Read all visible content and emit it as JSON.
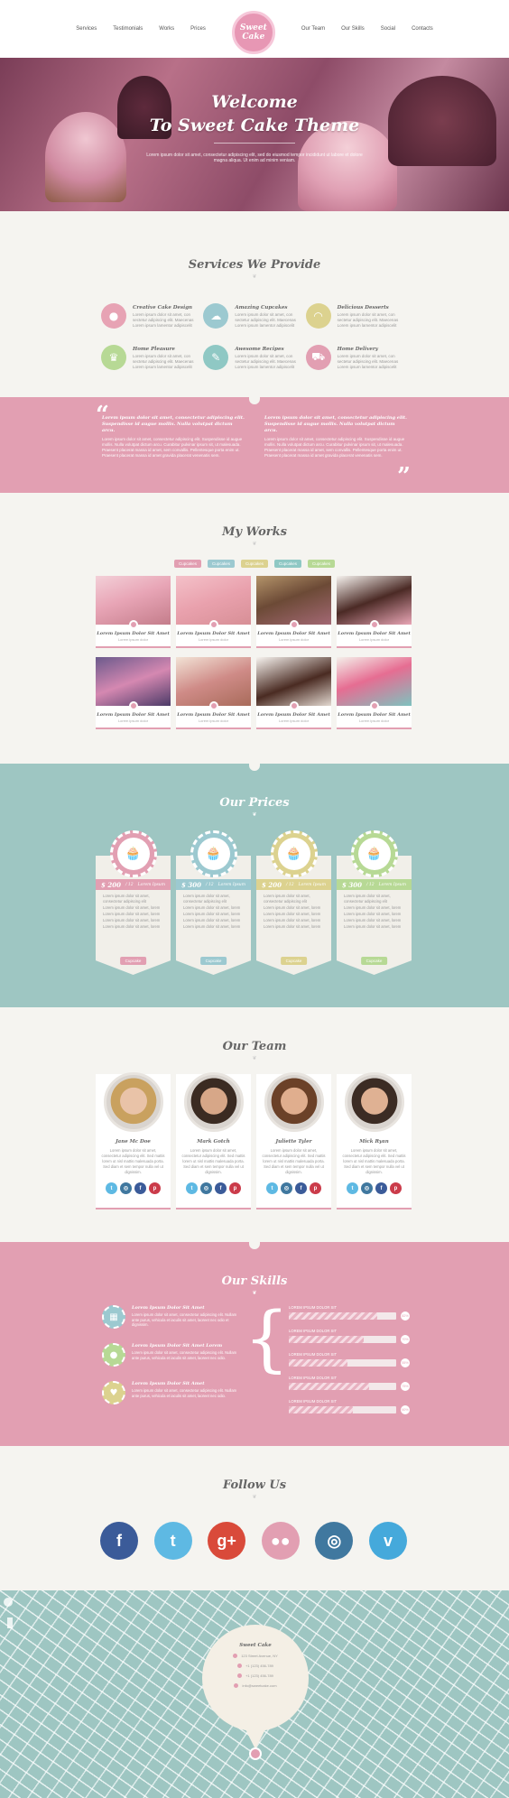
{
  "nav": {
    "left": [
      "Services",
      "Testimonials",
      "Works",
      "Prices"
    ],
    "right": [
      "Our Team",
      "Our Skills",
      "Social",
      "Contacts"
    ],
    "logo_line1": "Sweet",
    "logo_line2": "Cake"
  },
  "hero": {
    "line1": "Welcome",
    "line2": "To Sweet Cake Theme",
    "text": "Lorem ipsum dolor sit amet, consectetur adipiscing elit, sed do eiusmod tempor incididunt ut labore et dolore magna aliqua. Ut enim ad minim veniam."
  },
  "services": {
    "title": "Services We Provide",
    "items": [
      {
        "title": "Creative Cake Design",
        "text": "Lorem ipsum dolor sit amet, con sectetur adipiscing elit. Maecenas Lorem ipsum lamentor adipiscelit",
        "icon": "apple-icon",
        "color": "#e7a3b4"
      },
      {
        "title": "Amazing Cupcakes",
        "text": "Lorem ipsum dolor sit amet, con sectetur adipiscing elit. Maecenas Lorem ipsum lamentor adipiscelit",
        "icon": "cupcake-icon",
        "color": "#9cc9d0"
      },
      {
        "title": "Delicious Desserts",
        "text": "Lorem ipsum dolor sit amet, con sectetur adipiscing elit. Maecenas Lorem ipsum lamentor adipiscelit",
        "icon": "croissant-icon",
        "color": "#dcd28f"
      },
      {
        "title": "Home Pleasure",
        "text": "Lorem ipsum dolor sit amet, con sectetur adipiscing elit. Maecenas Lorem ipsum lamentor adipiscelit",
        "icon": "chef-hat-icon",
        "color": "#b7d995"
      },
      {
        "title": "Awesome Recipes",
        "text": "Lorem ipsum dolor sit amet, con sectetur adipiscing elit. Maecenas Lorem ipsum lamentor adipiscelit",
        "icon": "recipe-icon",
        "color": "#8fc8c4"
      },
      {
        "title": "Home Delivery",
        "text": "Lorem ipsum dolor sit amet, con sectetur adipiscing elit. Maecenas Lorem ipsum lamentor adipiscelit",
        "icon": "delivery-icon",
        "color": "#e29fb2"
      }
    ]
  },
  "testimonials": [
    {
      "quote": "Lorem ipsum dolor sit amet, consectetur adipiscing elit. Suspendisse id augue mollis. Nulla volutpat dictum arcu.",
      "text": "Lorem ipsum dolor sit amet, consectetur adipiscing elit. Suspendisse id augue mollis. Nulla volutpat dictum arcu. Curabitur pulvinar ipsum sit, ut malesuada. Praesent placerat massa id amet, sem convallis. Pellentesque porta enim ut. Praesent placerat massa id amet gravida placerat venenatis sem."
    },
    {
      "quote": "Lorem ipsum dolor sit amet, consectetur adipiscing elit. Suspendisse id augue mollis. Nulla volutpat dictum arcu.",
      "text": "Lorem ipsum dolor sit amet, consectetur adipiscing elit. Suspendisse id augue mollis. Nulla volutpat dictum arcu. Curabitur pulvinar ipsum sit, ut malesuada. Praesent placerat massa id amet, sem convallis. Pellentesque porta enim ut. Praesent placerat massa id amet gravida placerat venenatis sem."
    }
  ],
  "works": {
    "title": "My Works",
    "filters": [
      {
        "label": "Cupcakes",
        "color": "#e29fb2"
      },
      {
        "label": "Cupcakes",
        "color": "#9cc9d0"
      },
      {
        "label": "Cupcakes",
        "color": "#dcd28f"
      },
      {
        "label": "Cupcakes",
        "color": "#8fc8c4"
      },
      {
        "label": "Cupcakes",
        "color": "#b7d995"
      }
    ],
    "items": [
      {
        "title": "Lorem Ipsum Dolor Sit Amet",
        "sub": "Lorem ipsum dolor",
        "bg": "linear-gradient(160deg,#f3d0d8,#e8a5b6 45%,#c47d8b)"
      },
      {
        "title": "Lorem Ipsum Dolor Sit Amet",
        "sub": "Lorem ipsum dolor",
        "bg": "linear-gradient(160deg,#f4c1c9,#e9a1ad 50%,#d78f96)"
      },
      {
        "title": "Lorem Ipsum Dolor Sit Amet",
        "sub": "Lorem ipsum dolor",
        "bg": "linear-gradient(160deg,#b4946a,#6c4a36 45%,#a36874)"
      },
      {
        "title": "Lorem Ipsum Dolor Sit Amet",
        "sub": "Lorem ipsum dolor",
        "bg": "linear-gradient(160deg,#f6f2ee,#4b2a25 50%,#e9a6b6)"
      },
      {
        "title": "Lorem Ipsum Dolor Sit Amet",
        "sub": "Lorem ipsum dolor",
        "bg": "linear-gradient(160deg,#6b5a8c,#d588b1 50%,#4c3b68)"
      },
      {
        "title": "Lorem Ipsum Dolor Sit Amet",
        "sub": "Lorem ipsum dolor",
        "bg": "linear-gradient(160deg,#f2e3d6,#cf8b87 50%,#a86b5a)"
      },
      {
        "title": "Lorem Ipsum Dolor Sit Amet",
        "sub": "Lorem ipsum dolor",
        "bg": "linear-gradient(160deg,#f7f3ef,#4a2b22 55%,#e2d8d0)"
      },
      {
        "title": "Lorem Ipsum Dolor Sit Amet",
        "sub": "Lorem ipsum dolor",
        "bg": "linear-gradient(160deg,#f4f0ea,#e66d92 45%,#7ec2bf)"
      }
    ]
  },
  "prices": {
    "title": "Our Prices",
    "items": [
      {
        "price": "$ 200",
        "per": "/ 12",
        "name": "Lorem Ipsum",
        "color": "#e29fb2",
        "button": "Cupcake",
        "features": [
          "Lorem ipsum dolor sit amet, consectetur adipiscing elit",
          "Lorem ipsum dolor sit amet, lorem",
          "Lorem ipsum dolor sit amet, lorem",
          "Lorem ipsum dolor sit amet, lorem",
          "Lorem ipsum dolor sit amet, lorem"
        ]
      },
      {
        "price": "$ 300",
        "per": "/ 12",
        "name": "Lorem Ipsum",
        "color": "#9cc9d0",
        "button": "Cupcake",
        "features": [
          "Lorem ipsum dolor sit amet, consectetur adipiscing elit",
          "Lorem ipsum dolor sit amet, lorem",
          "Lorem ipsum dolor sit amet, lorem",
          "Lorem ipsum dolor sit amet, lorem",
          "Lorem ipsum dolor sit amet, lorem"
        ]
      },
      {
        "price": "$ 200",
        "per": "/ 12",
        "name": "Lorem Ipsum",
        "color": "#dcd28f",
        "button": "Cupcake",
        "features": [
          "Lorem ipsum dolor sit amet, consectetur adipiscing elit",
          "Lorem ipsum dolor sit amet, lorem",
          "Lorem ipsum dolor sit amet, lorem",
          "Lorem ipsum dolor sit amet, lorem",
          "Lorem ipsum dolor sit amet, lorem"
        ]
      },
      {
        "price": "$ 300",
        "per": "/ 12",
        "name": "Lorem Ipsum",
        "color": "#b7d995",
        "button": "Cupcake",
        "features": [
          "Lorem ipsum dolor sit amet, consectetur adipiscing elit",
          "Lorem ipsum dolor sit amet, lorem",
          "Lorem ipsum dolor sit amet, lorem",
          "Lorem ipsum dolor sit amet, lorem",
          "Lorem ipsum dolor sit amet, lorem"
        ]
      }
    ]
  },
  "team": {
    "title": "Our Team",
    "members": [
      {
        "name": "Jane Mc Doe",
        "text": "Lorem ipsum dolor sit amet, consectetur adipiscing elit. Sed mattis lorem ut nisl mattis malesuada porta. Sed diam et sem tempor nulla vel ut dignissim.",
        "skin": "#e9c3a8",
        "hair": "#c9a15f"
      },
      {
        "name": "Mark Gotch",
        "text": "Lorem ipsum dolor sit amet, consectetur adipiscing elit. Sed mattis lorem ut nisl mattis malesuada porta. Sed diam et sem tempor nulla vel ut dignissim.",
        "skin": "#d7a788",
        "hair": "#3b2b22"
      },
      {
        "name": "Juliette Tyler",
        "text": "Lorem ipsum dolor sit amet, consectetur adipiscing elit. Sed mattis lorem ut nisl mattis malesuada porta. Sed diam et sem tempor nulla vel ut dignissim.",
        "skin": "#e0ae8e",
        "hair": "#6b4128"
      },
      {
        "name": "Mick Ryan",
        "text": "Lorem ipsum dolor sit amet, consectetur adipiscing elit. Sed mattis lorem ut nisl mattis malesuada porta. Sed diam et sem tempor nulla vel ut dignissim.",
        "skin": "#dfb193",
        "hair": "#3c2c24"
      }
    ],
    "social": [
      {
        "icon": "twitter-icon",
        "glyph": "t",
        "color": "#5eb9e3"
      },
      {
        "icon": "instagram-icon",
        "glyph": "◎",
        "color": "#40789f"
      },
      {
        "icon": "facebook-icon",
        "glyph": "f",
        "color": "#3b5b99"
      },
      {
        "icon": "pinterest-icon",
        "glyph": "p",
        "color": "#cb3b4a"
      }
    ]
  },
  "skills": {
    "title": "Our Skills",
    "items": [
      {
        "title": "Lorem Ipsum Dolor Sit Amet",
        "text": "Lorem ipsum dolor sit amet, consectetur adipiscing elit. Nullam ante purus, vehicula et iaculis sit amet, laoreet nec odio et dignissim.",
        "icon": "calendar-icon",
        "glyph": "▦",
        "color": "#9cc9d0"
      },
      {
        "title": "Lorem Ipsum Dolor Sit Amet Lorem",
        "text": "Lorem ipsum dolor sit amet, consectetur adipiscing elit. Nullam ante purus, vehicula et iaculis sit amet, laoreet nec odio.",
        "icon": "apple-icon",
        "glyph": "●",
        "color": "#b7d995"
      },
      {
        "title": "Lorem Ipsum Dolor Sit Amet",
        "text": "Lorem ipsum dolor sit amet, consectetur adipiscing elit. Nullam ante purus, vehicula et iaculis sit amet, laoreet nec odio.",
        "icon": "heart-icon",
        "glyph": "♥",
        "color": "#dcd28f"
      }
    ],
    "bars": [
      {
        "label": "LOREM IPSUM DOLOR SIT",
        "value": 0.82,
        "pct": "82%"
      },
      {
        "label": "LOREM IPSUM DOLOR SIT",
        "value": 0.7,
        "pct": "70%"
      },
      {
        "label": "LOREM IPSUM DOLOR SIT",
        "value": 0.55,
        "pct": "55%"
      },
      {
        "label": "LOREM IPSUM DOLOR SIT",
        "value": 0.75,
        "pct": "75%"
      },
      {
        "label": "LOREM IPSUM DOLOR SIT",
        "value": 0.6,
        "pct": "60%"
      }
    ]
  },
  "follow": {
    "title": "Follow Us",
    "networks": [
      {
        "icon": "facebook-icon",
        "glyph": "f",
        "color": "#3b5b99"
      },
      {
        "icon": "twitter-icon",
        "glyph": "t",
        "color": "#5eb9e3"
      },
      {
        "icon": "google-plus-icon",
        "glyph": "g+",
        "color": "#d94a3a"
      },
      {
        "icon": "flickr-icon",
        "glyph": "●●",
        "color": "#e29fb2"
      },
      {
        "icon": "instagram-icon",
        "glyph": "◎",
        "color": "#40789f"
      },
      {
        "icon": "vimeo-icon",
        "glyph": "v",
        "color": "#45a9db"
      }
    ]
  },
  "contact": {
    "title": "Sweet Cake",
    "lines": [
      "123 Street Avenue, NY",
      "+1 (123) 456-789",
      "+1 (123) 456-789",
      "info@sweetcake.com"
    ]
  }
}
